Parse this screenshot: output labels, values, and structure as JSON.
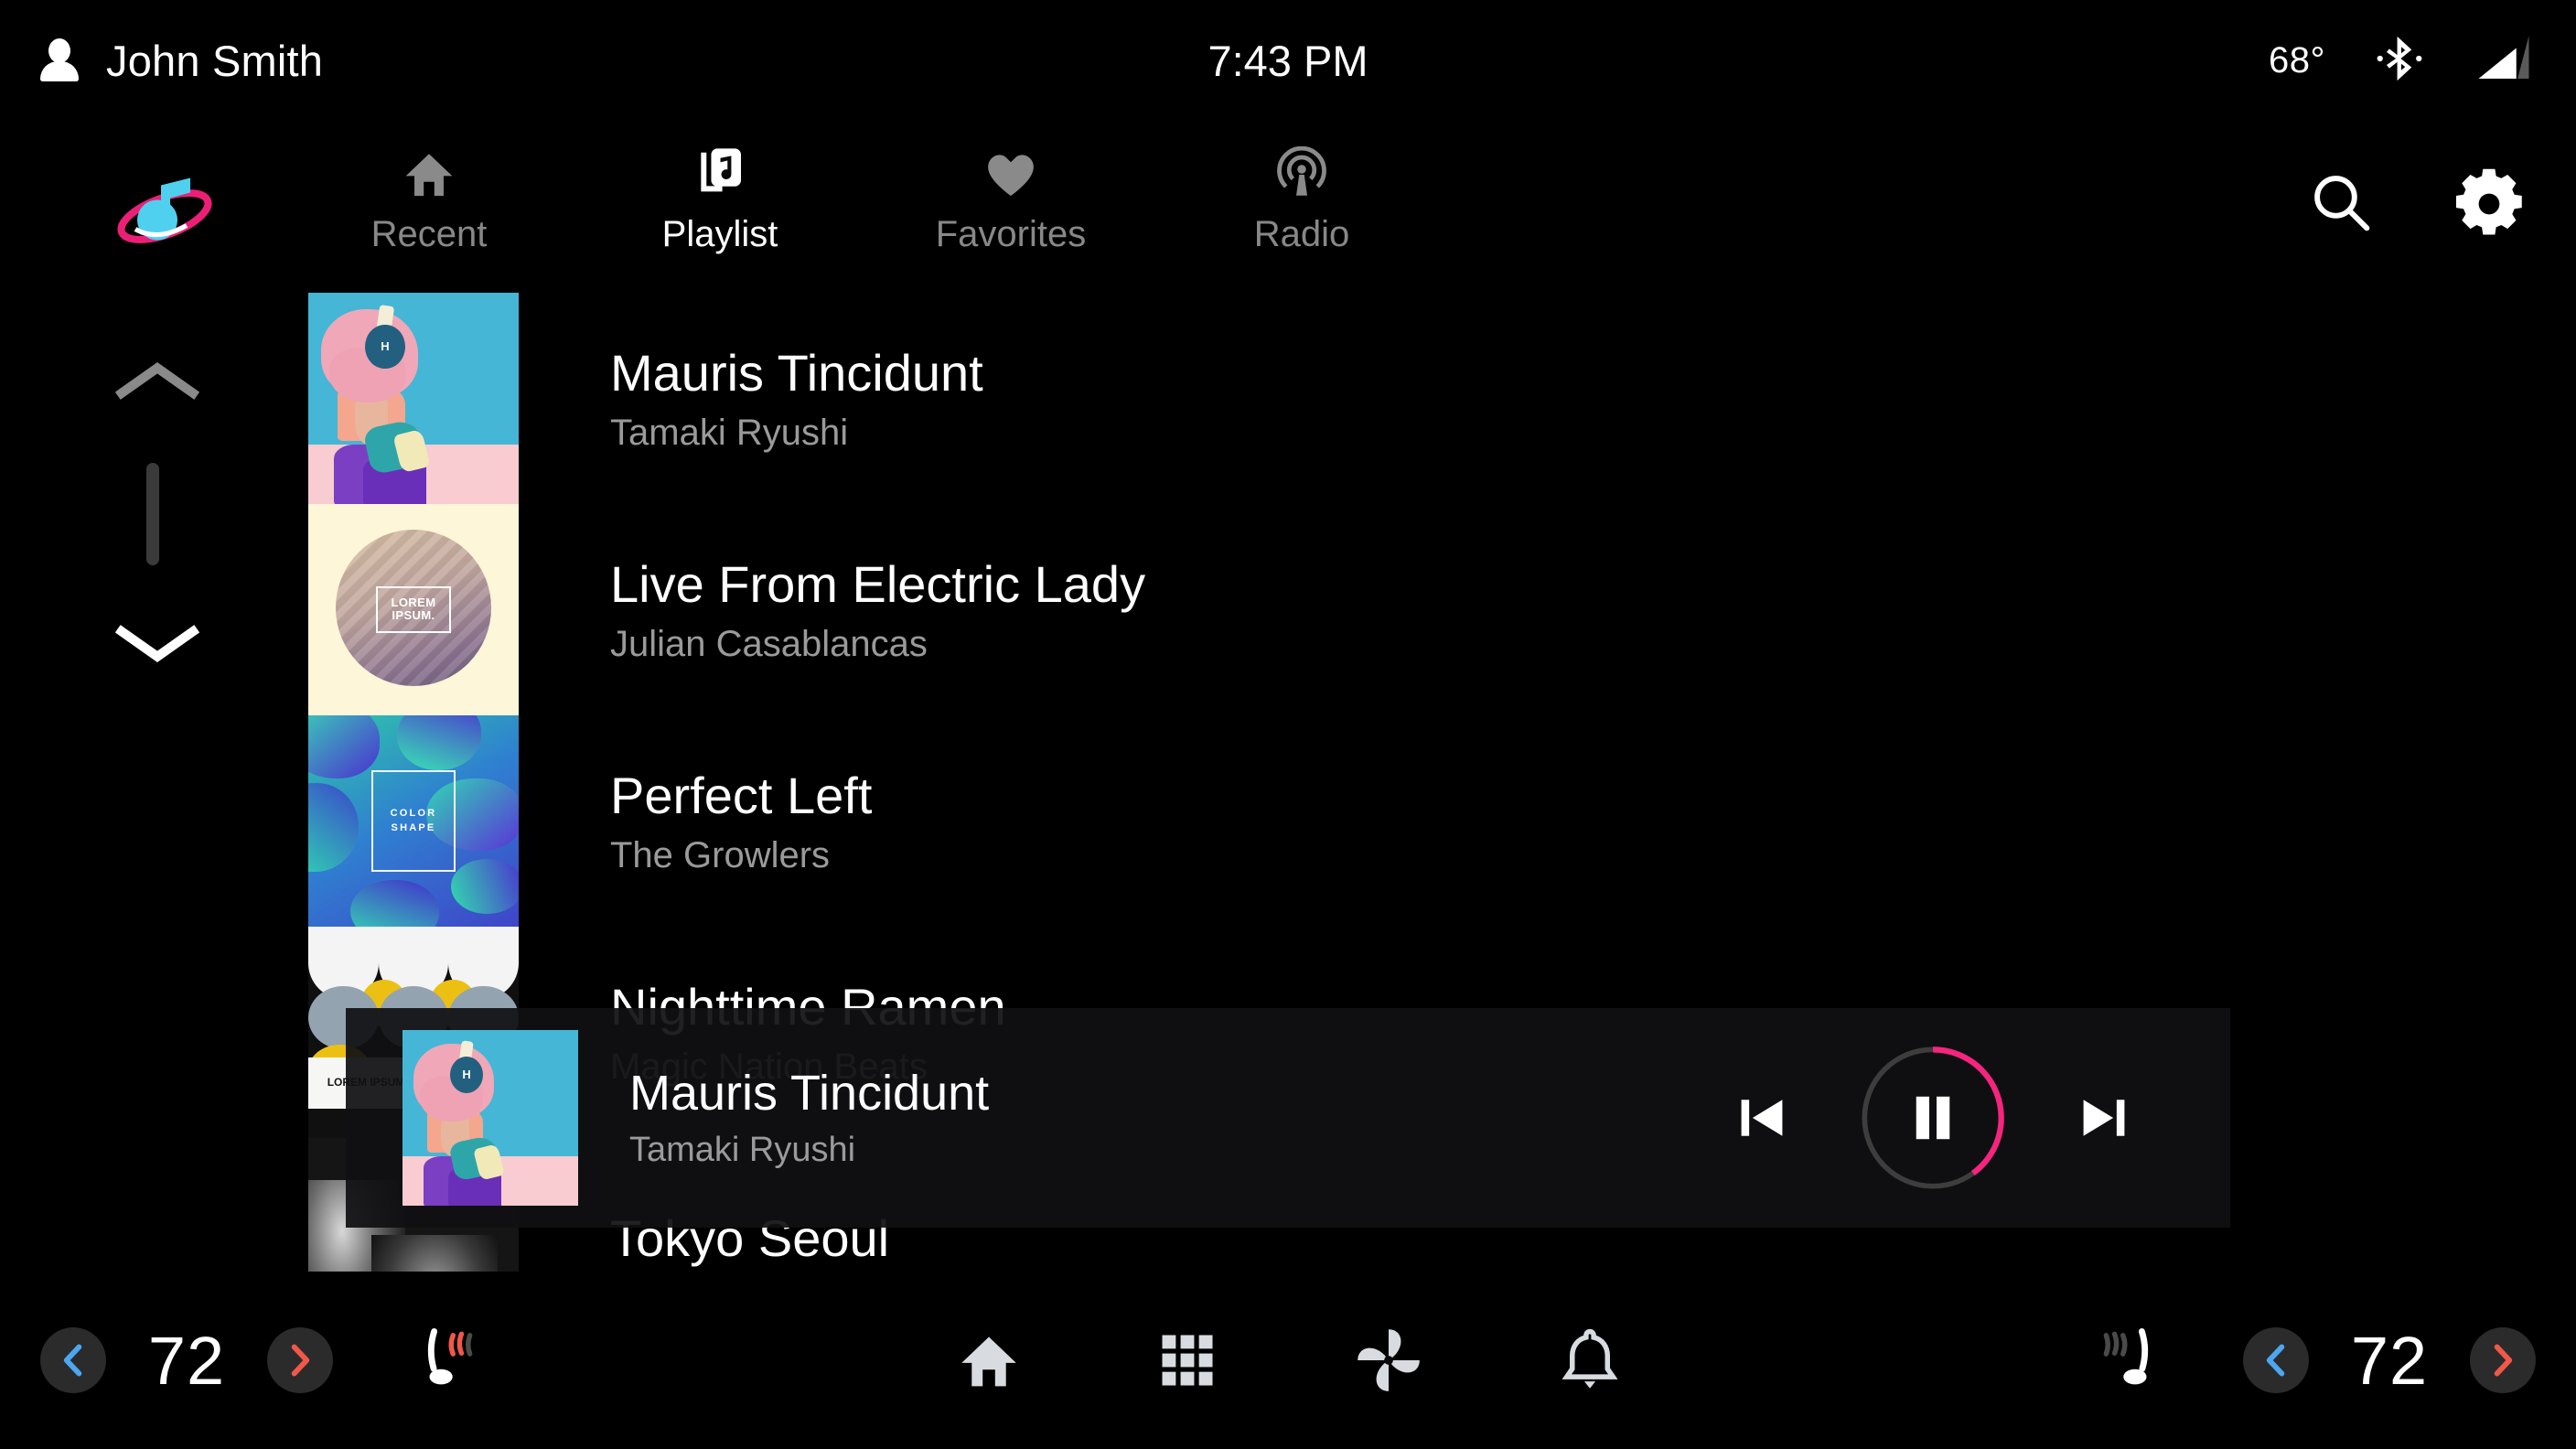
{
  "status_bar": {
    "user_name": "John Smith",
    "user_icon": "person-icon",
    "time": "7:43 PM",
    "temperature": "68°",
    "bluetooth_icon": "bluetooth-icon",
    "signal_icon": "cellular-signal-icon"
  },
  "app": {
    "logo_icon": "music-note-orbit-logo",
    "tabs": [
      {
        "label": "Recent",
        "icon": "home-icon",
        "active": false
      },
      {
        "label": "Playlist",
        "icon": "playlist-icon",
        "active": true
      },
      {
        "label": "Favorites",
        "icon": "heart-icon",
        "active": false
      },
      {
        "label": "Radio",
        "icon": "radio-waves-icon",
        "active": false
      }
    ],
    "search_icon": "search-icon",
    "settings_icon": "gear-icon"
  },
  "scroll": {
    "up_icon": "chevron-up-icon",
    "down_icon": "chevron-down-icon"
  },
  "playlist": {
    "tracks": [
      {
        "title": "Mauris Tincidunt",
        "artist": "Tamaki Ryushi",
        "art": "girl"
      },
      {
        "title": "Live From Electric Lady",
        "artist": "Julian Casablancas",
        "art": "sphere"
      },
      {
        "title": "Perfect Left",
        "artist": "The Growlers",
        "art": "blob"
      },
      {
        "title": "Nighttime Ramen",
        "artist": "Magic Nation Beats",
        "art": "circles"
      },
      {
        "title": "Tokyo Seoul",
        "artist": "",
        "art": "crowd"
      }
    ],
    "art_labels": {
      "sphere": "LOREM IPSUM.",
      "blob": "COLOR SHAPE",
      "circles": "LOREM IPSUM."
    }
  },
  "now_playing": {
    "title": "Mauris Tincidunt",
    "artist": "Tamaki Ryushi",
    "art": "girl",
    "is_playing": true,
    "progress_percent": 40,
    "progress_color": "#f5257f",
    "track_color": "#3d3d3d",
    "prev_icon": "skip-previous-icon",
    "play_pause_icon": "pause-icon",
    "next_icon": "skip-next-icon"
  },
  "climate": {
    "left": {
      "value": "72",
      "decrease_icon": "chevron-left-icon",
      "increase_icon": "chevron-right-icon",
      "seat_heater_icon": "heated-seat-icon",
      "seat_heater_active": true
    },
    "right": {
      "value": "72",
      "decrease_icon": "chevron-left-icon",
      "increase_icon": "chevron-right-icon",
      "seat_heater_icon": "heated-seat-icon",
      "seat_heater_active": false
    },
    "decrease_color": "#4da6f0",
    "increase_color": "#f0584a"
  },
  "nav": {
    "items": [
      {
        "icon": "home-icon",
        "name": "nav-home"
      },
      {
        "icon": "apps-grid-icon",
        "name": "nav-apps"
      },
      {
        "icon": "fan-icon",
        "name": "nav-climate"
      },
      {
        "icon": "bell-icon",
        "name": "nav-notifications"
      }
    ]
  }
}
